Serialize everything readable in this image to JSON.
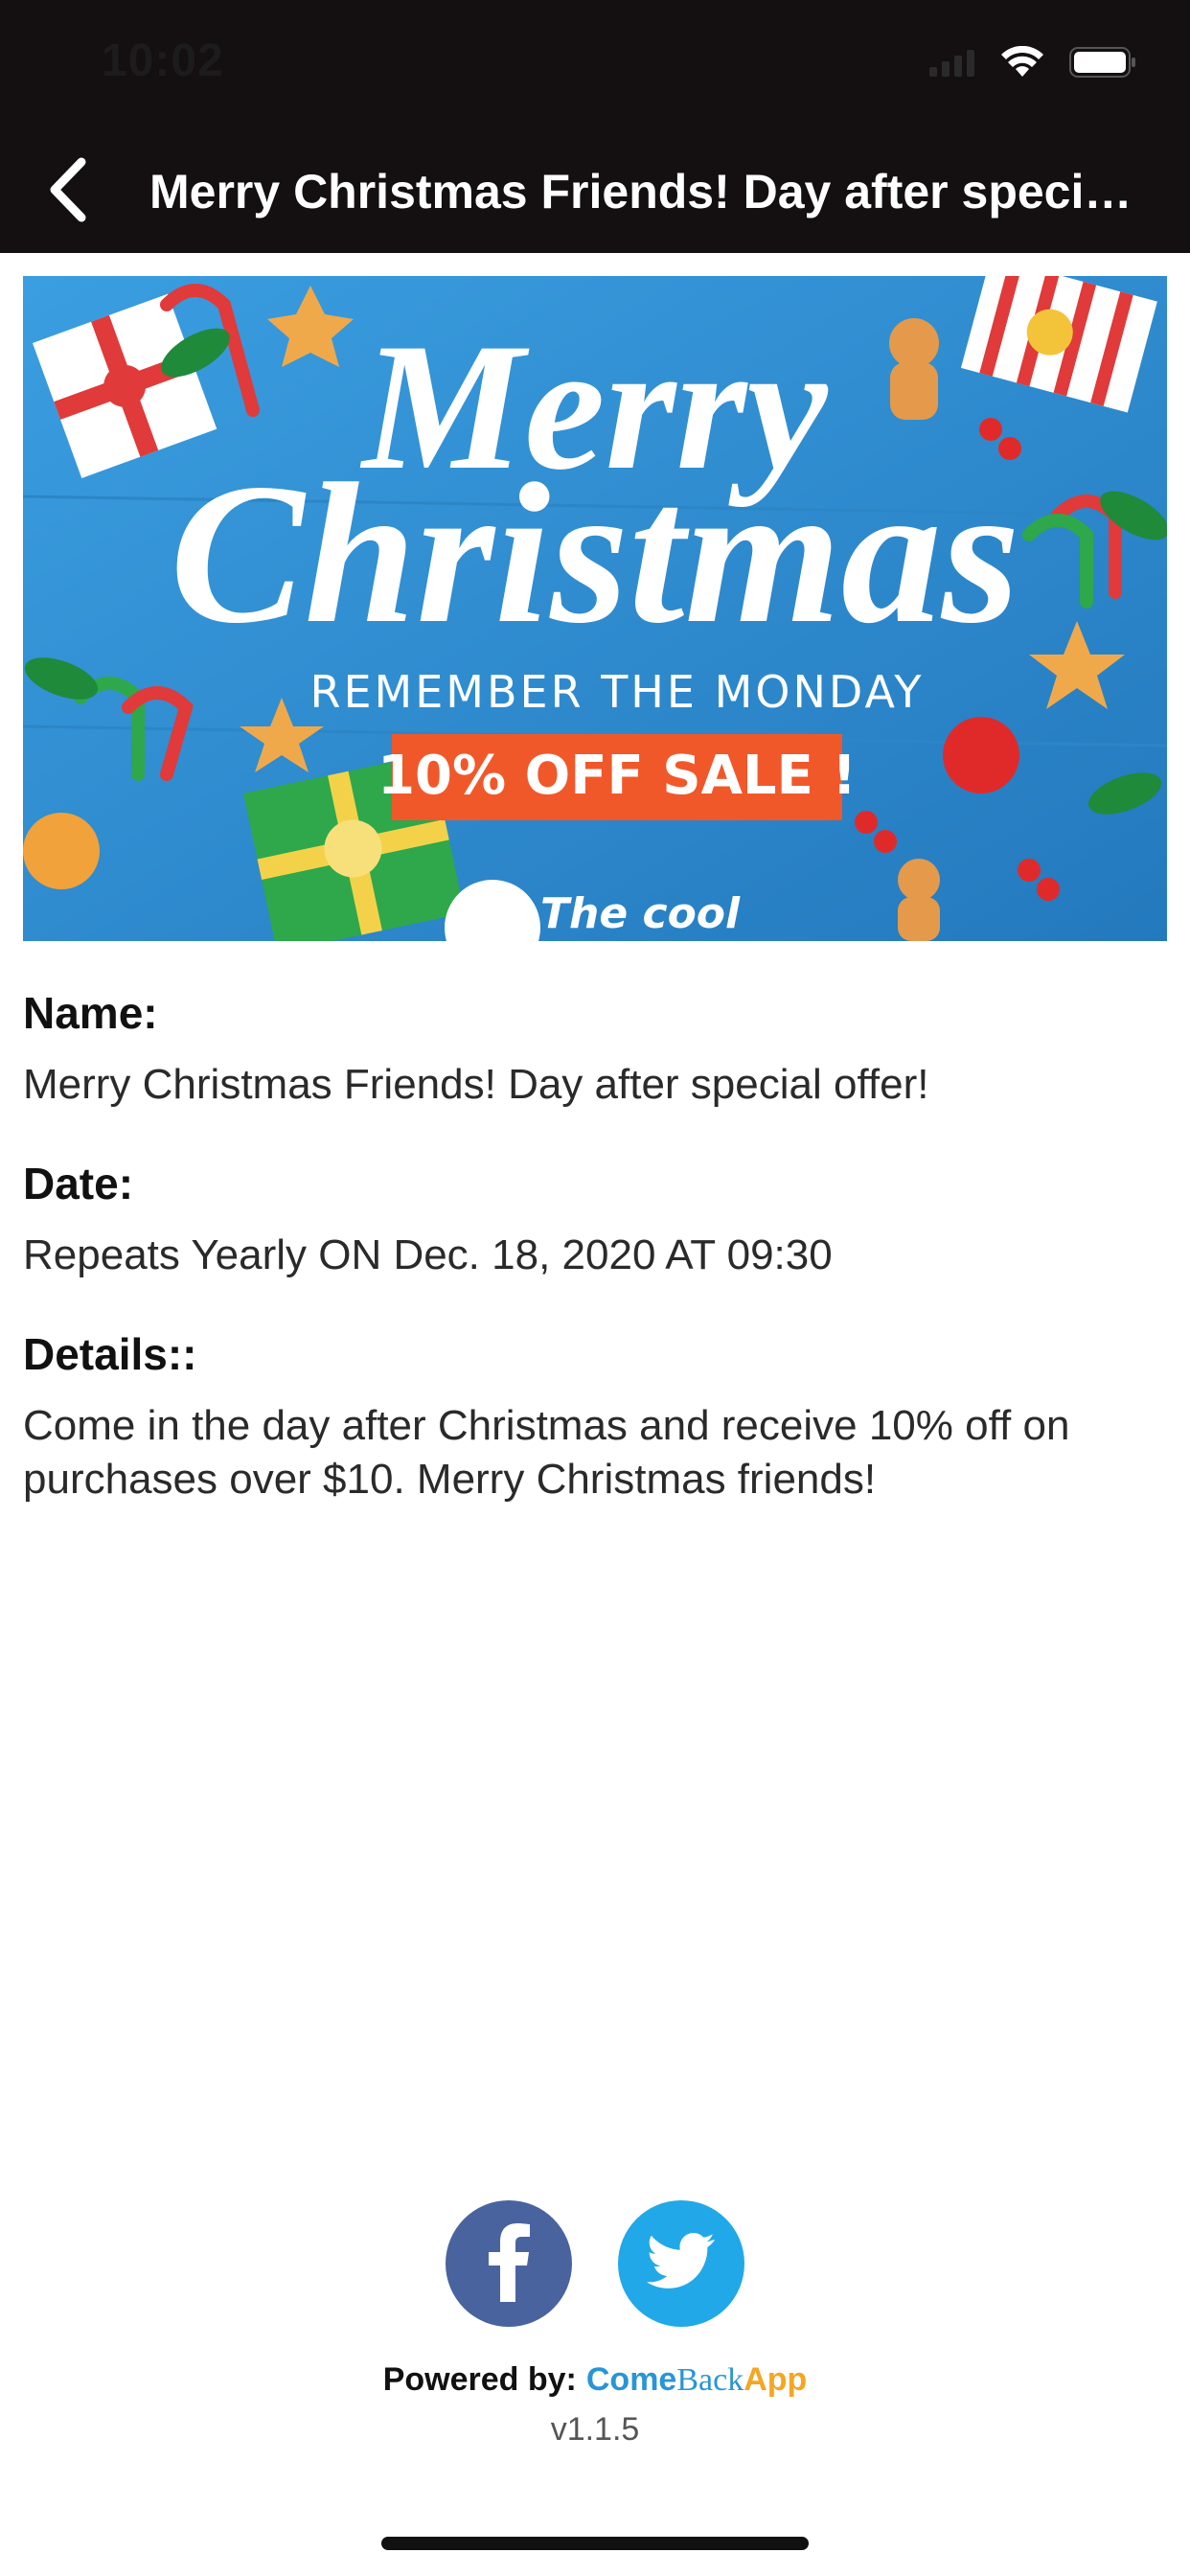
{
  "status_bar": {
    "time": "10:02"
  },
  "nav": {
    "title": "Merry Christmas Friends! Day after special offer!"
  },
  "banner": {
    "headline_line1": "Merry",
    "headline_line2": "Christmas",
    "subtitle": "REMEMBER THE MONDAY",
    "sale": "10% OFF SALE !",
    "brand_partial": "The cool"
  },
  "details": {
    "name_label": "Name:",
    "name_value": "Merry Christmas Friends! Day after special offer!",
    "date_label": "Date:",
    "date_value": "Repeats Yearly ON Dec. 18, 2020 AT 09:30",
    "details_label": "Details::",
    "details_value": "Come in the day after Christmas and receive 10% off on purchases over $10. Merry Christmas friends!"
  },
  "footer": {
    "powered_label": "Powered by:",
    "brand_come": "Come",
    "brand_back": "Back",
    "brand_app": "App",
    "version": "v1.1.5"
  },
  "colors": {
    "header_bg": "#140f10",
    "facebook": "#49639e",
    "twitter": "#21a8e8",
    "brand_blue": "#2a95d6",
    "brand_orange": "#f5a623",
    "banner_blue": "#2f8ed0",
    "sale_orange": "#f0582a"
  },
  "icons": {
    "back": "chevron-left-icon",
    "wifi": "wifi-icon",
    "battery": "battery-icon",
    "facebook": "facebook-icon",
    "twitter": "twitter-icon"
  }
}
